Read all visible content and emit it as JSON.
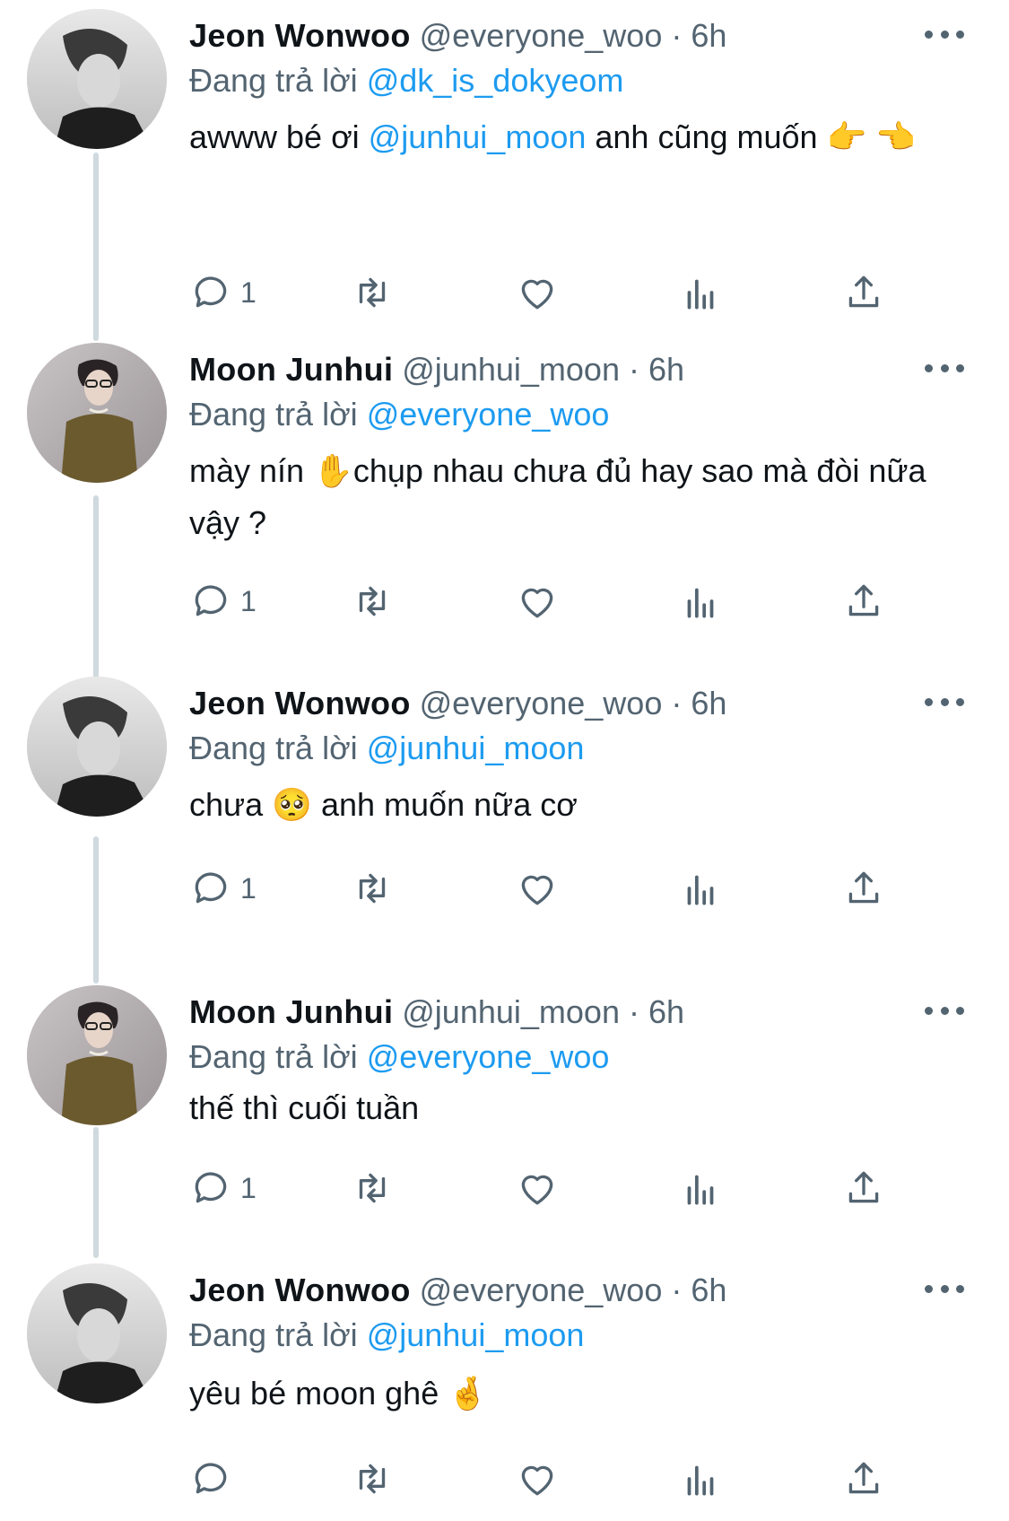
{
  "tweets": [
    {
      "name": "Jeon Wonwoo",
      "handle": "@everyone_woo",
      "dot": "·",
      "time": "6h",
      "replying_prefix": "Đang trả lời",
      "replying_to": "@dk_is_dokyeom",
      "body_before": "awww bé ơi ",
      "body_mention": "@junhui_moon",
      "body_after": " anh cũng muốn 👉 👈",
      "reply_count": "1",
      "avatar": "avatar-wonwoo"
    },
    {
      "name": "Moon Junhui",
      "handle": "@junhui_moon",
      "dot": "·",
      "time": "6h",
      "replying_prefix": "Đang trả lời",
      "replying_to": "@everyone_woo",
      "body": "mày nín ✋chụp nhau chưa đủ hay sao mà đòi nữa vậy ?",
      "reply_count": "1",
      "avatar": "avatar-junhui"
    },
    {
      "name": "Jeon Wonwoo",
      "handle": "@everyone_woo",
      "dot": "·",
      "time": "6h",
      "replying_prefix": "Đang trả lời",
      "replying_to": "@junhui_moon",
      "body": "chưa 🥺  anh muốn nữa cơ",
      "reply_count": "1",
      "avatar": "avatar-wonwoo"
    },
    {
      "name": "Moon Junhui",
      "handle": "@junhui_moon",
      "dot": "·",
      "time": "6h",
      "replying_prefix": "Đang trả lời",
      "replying_to": "@everyone_woo",
      "body": "thế thì cuối tuần",
      "reply_count": "1",
      "avatar": "avatar-junhui"
    },
    {
      "name": "Jeon Wonwoo",
      "handle": "@everyone_woo",
      "dot": "·",
      "time": "6h",
      "replying_prefix": "Đang trả lời",
      "replying_to": "@junhui_moon",
      "body": "yêu bé moon ghê 🤞",
      "reply_count": "",
      "avatar": "avatar-wonwoo"
    }
  ],
  "icons": {
    "reply": "reply-bubble-icon",
    "retweet": "retweet-icon",
    "like": "heart-icon",
    "views": "views-chart-icon",
    "share": "share-upload-icon",
    "more": "more-horizontal-icon"
  },
  "colors": {
    "text": "#0f1419",
    "secondary": "#536471",
    "mention": "#1d9bf0",
    "thread_line": "#cfd9de"
  }
}
